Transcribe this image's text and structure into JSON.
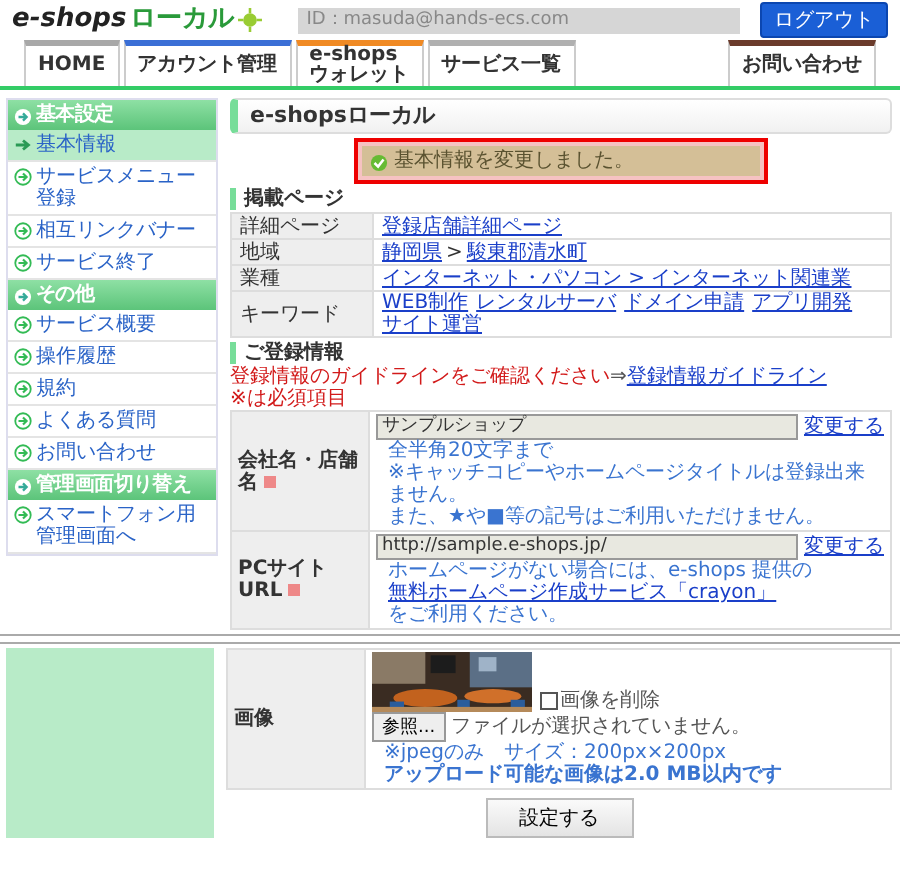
{
  "header": {
    "logo": {
      "primary": "e-shops",
      "secondary": "ローカル"
    },
    "account_id": "ID：masuda@hands-ecs.com",
    "logout": "ログアウト"
  },
  "tabs": [
    {
      "label": "HOME",
      "color": "#a8a8a8"
    },
    {
      "label": "アカウント管理",
      "color": "#3b6fd6"
    },
    {
      "label": "e-shops\nウォレット",
      "color": "#f08a24"
    },
    {
      "label": "サービス一覧",
      "color": "#b0b0b0"
    }
  ],
  "tabs_right": [
    {
      "label": "お問い合わせ",
      "color": "#6b3b2b"
    }
  ],
  "sidebar": {
    "groups": [
      {
        "title": "基本設定",
        "items": [
          {
            "label": "基本情報",
            "selected": true
          },
          {
            "label": "サービスメニュー登録",
            "selected": false
          },
          {
            "label": "相互リンクバナー",
            "selected": false
          },
          {
            "label": "サービス終了",
            "selected": false
          }
        ]
      },
      {
        "title": "その他",
        "items": [
          {
            "label": "サービス概要",
            "selected": false
          },
          {
            "label": "操作履歴",
            "selected": false
          },
          {
            "label": "規約",
            "selected": false
          },
          {
            "label": "よくある質問",
            "selected": false
          },
          {
            "label": "お問い合わせ",
            "selected": false
          }
        ]
      },
      {
        "title": "管理画面切り替え",
        "items": [
          {
            "label": "スマートフォン用管理画面へ",
            "selected": false
          }
        ]
      }
    ]
  },
  "page_title": "e-shopsローカル",
  "message": "基本情報を変更しました。",
  "listing": {
    "heading": "掲載ページ",
    "rows": [
      {
        "label": "詳細ページ",
        "links": [
          "登録店舗詳細ページ"
        ]
      },
      {
        "label": "地域",
        "links": [
          "静岡県",
          "駿東郡清水町"
        ],
        "separator": ">"
      },
      {
        "label": "業種",
        "links": [
          "インターネット・パソコン > インターネット関連業"
        ]
      },
      {
        "label": "キーワード",
        "links": [
          "WEB制作",
          "レンタルサーバ",
          "ドメイン申請",
          "アプリ開発",
          "サイト運営"
        ]
      }
    ]
  },
  "registration": {
    "heading": "ご登録情報",
    "guideline": {
      "text": "登録情報のガイドラインをご確認ください",
      "arrow": "⇒",
      "link": "登録情報ガイドライン"
    },
    "required_note": "※は必須項目",
    "fields": [
      {
        "label": "会社名・店舗名",
        "required": true,
        "value": "サンプルショップ",
        "change": "変更する",
        "notes": [
          "全半角20文字まで",
          "※キャッチコピーやホームページタイトルは登録出来ません。",
          "また、★や■等の記号はご利用いただけません。"
        ]
      },
      {
        "label": "PCサイトURL",
        "required": true,
        "value": "http://sample.e-shops.jp/",
        "change": "変更する",
        "notes": [
          "ホームページがない場合には、e-shops 提供の"
        ],
        "link": "無料ホームページ作成サービス「crayon」",
        "link_suffix": "をご利用ください。"
      }
    ],
    "image": {
      "label": "画像",
      "delete_label": "画像を削除",
      "delete_checked": false,
      "browse": "参照...",
      "no_file": "ファイルが選択されていません。",
      "note": "※jpegのみ　サイズ：200px×200px",
      "limit": "アップロード可能な画像は2.0 MB以内です"
    },
    "submit": "設定する"
  }
}
